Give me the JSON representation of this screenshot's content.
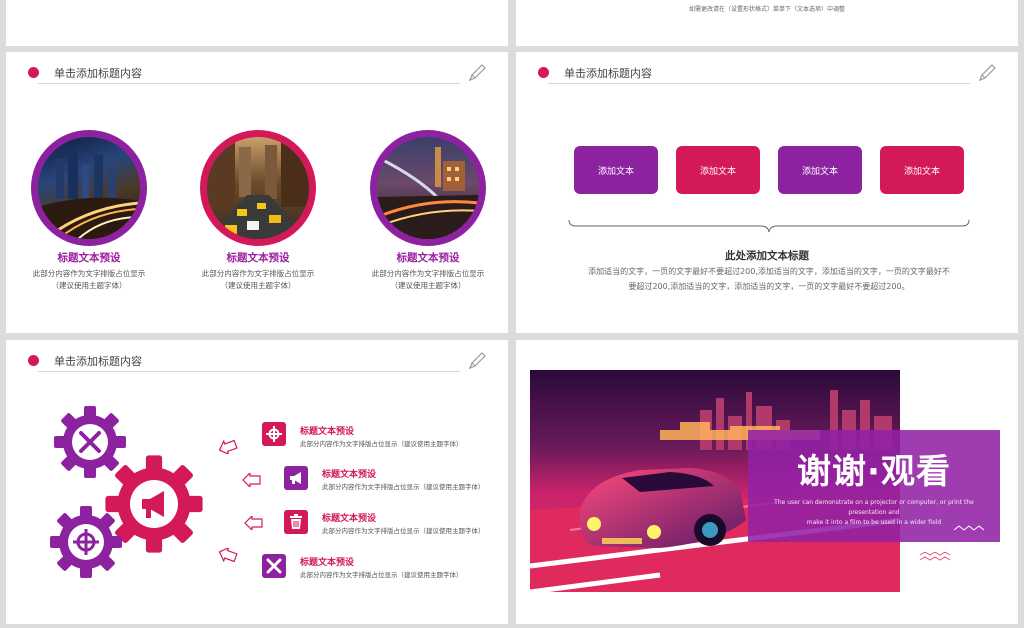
{
  "top_note": "如需更改请在（设置形状格式）菜单下（文本选项）中调整",
  "slide_header_title": "单击添加标题内容",
  "slide1": {
    "items": [
      {
        "title": "标题文本预设",
        "desc_line1": "此部分内容作为文字排版占位显示",
        "desc_line2": "（建议使用主题字体）"
      },
      {
        "title": "标题文本预设",
        "desc_line1": "此部分内容作为文字排版占位显示",
        "desc_line2": "（建议使用主题字体）"
      },
      {
        "title": "标题文本预设",
        "desc_line1": "此部分内容作为文字排版占位显示",
        "desc_line2": "（建议使用主题字体）"
      }
    ]
  },
  "slide2": {
    "buttons": [
      "添加文本",
      "添加文本",
      "添加文本",
      "添加文本"
    ],
    "title": "此处添加文本标题",
    "body_line1": "添加适当的文字，一页的文字最好不要超过200,添加适当的文字，添加适当的文字，一页的文字最好不",
    "body_line2": "要超过200,添加适当的文字，添加适当的文字，一页的文字最好不要超过200。"
  },
  "slide3": {
    "items": [
      {
        "title": "标题文本预设",
        "desc": "此部分内容作为文字排版占位显示（建议使用主题字体）",
        "icon": "crosshair-icon"
      },
      {
        "title": "标题文本预设",
        "desc": "此部分内容作为文字排版占位显示（建议使用主题字体）",
        "icon": "megaphone-icon"
      },
      {
        "title": "标题文本预设",
        "desc": "此部分内容作为文字排版占位显示（建议使用主题字体）",
        "icon": "trash-icon"
      },
      {
        "title": "标题文本预设",
        "desc": "此部分内容作为文字排版占位显示（建议使用主题字体）",
        "icon": "tools-icon"
      }
    ]
  },
  "slide4": {
    "title": "谢谢·观看",
    "sub_line1": "The user can demonstrate on a projector or computer, or print the presentation and",
    "sub_line2": "make it into a film to be used in a wider field"
  },
  "colors": {
    "magenta": "#d3195a",
    "purple": "#9c1fa0",
    "grey_text": "#555555"
  }
}
